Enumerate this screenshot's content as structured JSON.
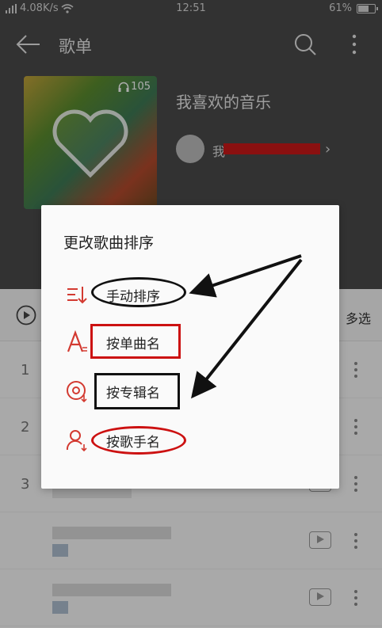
{
  "status_bar": {
    "network": "4.08K/s",
    "time": "12:51",
    "battery": "61%"
  },
  "app_bar": {
    "title": "歌单"
  },
  "playlist": {
    "cover_play_count": "105",
    "name": "我喜欢的音乐",
    "creator_prefix": "我"
  },
  "list_header": {
    "multi_select": "多选"
  },
  "songs": [
    {
      "index": "1"
    },
    {
      "index": "2"
    },
    {
      "index": "3"
    }
  ],
  "sort_dialog": {
    "title": "更改歌曲排序",
    "options": [
      {
        "label": "手动排序",
        "icon": "manual-sort-icon"
      },
      {
        "label": "按单曲名",
        "icon": "letter-a-icon"
      },
      {
        "label": "按专辑名",
        "icon": "disc-icon"
      },
      {
        "label": "按歌手名",
        "icon": "person-icon"
      }
    ]
  },
  "colors": {
    "accent_red": "#d33a31",
    "annotation_red": "#cc1111",
    "annotation_black": "#111111",
    "dark_header": "#4b4b4b"
  }
}
